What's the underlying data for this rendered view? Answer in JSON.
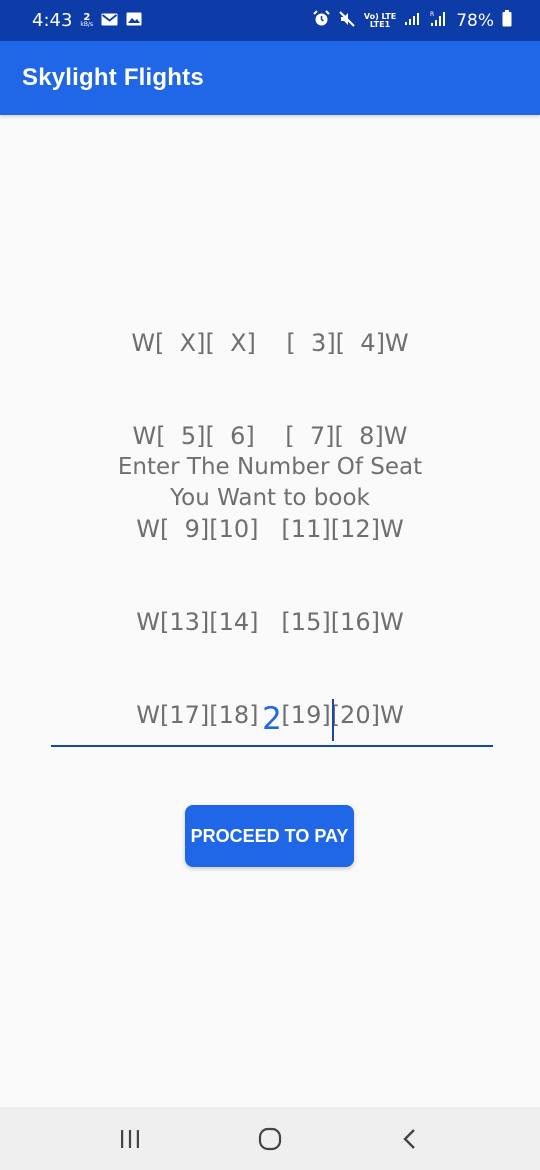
{
  "status_bar": {
    "time": "4:43",
    "net_speed_value": "2",
    "net_speed_unit": "kB/s",
    "network_top": "Vo) LTE",
    "network_bottom": "LTE1",
    "battery_percent": "78%",
    "icons": [
      "gmail-icon",
      "gallery-icon",
      "alarm-icon",
      "mute-icon",
      "signal-icon",
      "signal-roaming-icon",
      "battery-icon"
    ]
  },
  "app_bar": {
    "title": "Skylight Flights"
  },
  "seat_map": {
    "rows": [
      "W[  X][  X]    [  3][  4]W",
      "W[  5][  6]    [  7][  8]W",
      "W[  9][10]   [11][12]W",
      "W[13][14]   [15][16]W",
      "W[17][18]   [19][20]W"
    ]
  },
  "prompt": {
    "line1": "Enter The Number Of Seat",
    "line2": "You Want to book"
  },
  "seat_input": {
    "value": "2",
    "placeholder": ""
  },
  "proceed_button": {
    "label": "PROCEED TO PAY"
  },
  "nav_bar": {
    "icons": [
      "recent-apps-icon",
      "home-icon",
      "back-icon"
    ]
  },
  "colors": {
    "status_bar": "#0d3ca8",
    "app_bar": "#1f67e6",
    "accent": "#1f67e6",
    "text_gray": "#6f6f6f",
    "background": "#fafafa"
  }
}
